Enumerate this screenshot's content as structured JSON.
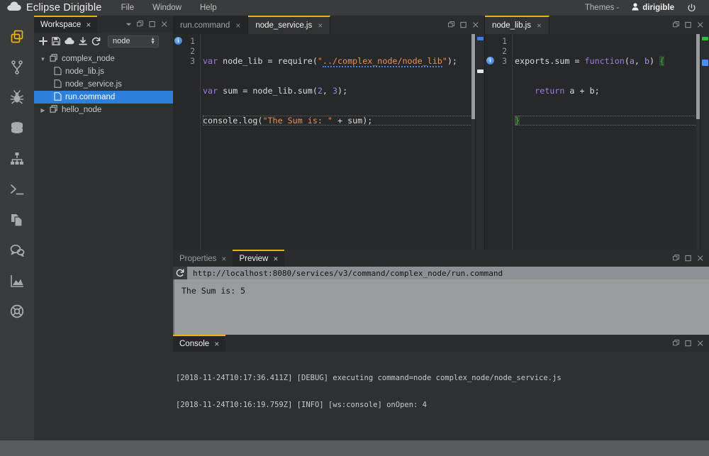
{
  "app": {
    "brand": "Eclipse Dirigible",
    "brand_icon": "cloud-icon",
    "menus": [
      "File",
      "Window",
      "Help"
    ],
    "themes_label": "Themes",
    "themes_caret": "-",
    "user": "dirigible",
    "user_icon": "user-icon",
    "power_icon": "power-icon"
  },
  "rail": {
    "items": [
      {
        "name": "workspace-icon",
        "label": "Workspace",
        "active": true
      },
      {
        "name": "git-branch-icon",
        "label": "Git",
        "active": false
      },
      {
        "name": "bug-icon",
        "label": "Debugger",
        "active": false
      },
      {
        "name": "database-icon",
        "label": "Database",
        "active": false
      },
      {
        "name": "sitemap-icon",
        "label": "Flow",
        "active": false
      },
      {
        "name": "terminal-icon",
        "label": "Terminal",
        "active": false
      },
      {
        "name": "documents-icon",
        "label": "Documents",
        "active": false
      },
      {
        "name": "chat-icon",
        "label": "Discussions",
        "active": false
      },
      {
        "name": "chart-icon",
        "label": "Analytics",
        "active": false
      },
      {
        "name": "lifebuoy-icon",
        "label": "Help",
        "active": false
      }
    ]
  },
  "explorer": {
    "tab": "Workspace",
    "tab_close": "×",
    "controls": [
      "chevron-down-icon",
      "restore-icon",
      "maximize-icon",
      "close-icon"
    ],
    "toolbar": {
      "icons": [
        "plus-icon",
        "save-icon",
        "cloud-upload-icon",
        "download-icon",
        "refresh-icon"
      ],
      "workspace_select": "node"
    },
    "tree": [
      {
        "label": "complex_node",
        "depth": 0,
        "kind": "project",
        "expanded": true,
        "selected": false
      },
      {
        "label": "node_lib.js",
        "depth": 1,
        "kind": "file",
        "selected": false
      },
      {
        "label": "node_service.js",
        "depth": 1,
        "kind": "file",
        "selected": false
      },
      {
        "label": "run.command",
        "depth": 1,
        "kind": "file",
        "selected": true
      },
      {
        "label": "hello_node",
        "depth": 0,
        "kind": "project",
        "expanded": false,
        "selected": false
      }
    ]
  },
  "editor_left": {
    "tabs": [
      {
        "label": "run.command",
        "active": false,
        "close": "×"
      },
      {
        "label": "node_service.js",
        "active": true,
        "close": "×"
      }
    ],
    "controls": [
      "restore-icon",
      "maximize-icon",
      "close-icon"
    ],
    "lines": [
      {
        "number": "1",
        "marker": "info-icon",
        "cursor": false
      },
      {
        "number": "2",
        "marker": "",
        "cursor": false
      },
      {
        "number": "3",
        "marker": "",
        "cursor": true
      }
    ],
    "code_text": [
      "var node_lib = require(\"../complex_node/node_lib\");",
      "var sum = node_lib.sum(2, 3);",
      "console.log(\"The Sum is: \" + sum);"
    ]
  },
  "editor_right": {
    "tabs": [
      {
        "label": "node_lib.js",
        "active": true,
        "close": "×"
      }
    ],
    "controls": [
      "restore-icon",
      "maximize-icon",
      "close-icon"
    ],
    "lines": [
      {
        "number": "1",
        "marker": "",
        "cursor": false
      },
      {
        "number": "2",
        "marker": "",
        "cursor": false
      },
      {
        "number": "3",
        "marker": "info-icon",
        "cursor": true
      }
    ],
    "code_text": [
      "exports.sum = function(a, b) {",
      "    return a + b;",
      "}"
    ]
  },
  "preview": {
    "tabs": [
      {
        "label": "Properties",
        "active": false,
        "close": "×"
      },
      {
        "label": "Preview",
        "active": true,
        "close": "×"
      }
    ],
    "controls": [
      "restore-icon",
      "maximize-icon",
      "close-icon"
    ],
    "reload_icon": "refresh-icon",
    "url": "http://localhost:8080/services/v3/command/complex_node/run.command",
    "content": "The Sum is: 5"
  },
  "console": {
    "tabs": [
      {
        "label": "Console",
        "active": true,
        "close": "×"
      }
    ],
    "controls": [
      "restore-icon",
      "maximize-icon",
      "close-icon"
    ],
    "lines": [
      "[2018-11-24T10:17:36.411Z] [DEBUG] executing command=node complex_node/node_service.js",
      "[2018-11-24T10:16:19.759Z] [INFO] [ws:console] onOpen: 4"
    ]
  },
  "colors": {
    "accent": "#e8b413",
    "selection": "#2c7fdb",
    "panel_bg": "#2f3032",
    "editor_bg": "#272829",
    "topbar_bg": "#3a3b3d"
  }
}
